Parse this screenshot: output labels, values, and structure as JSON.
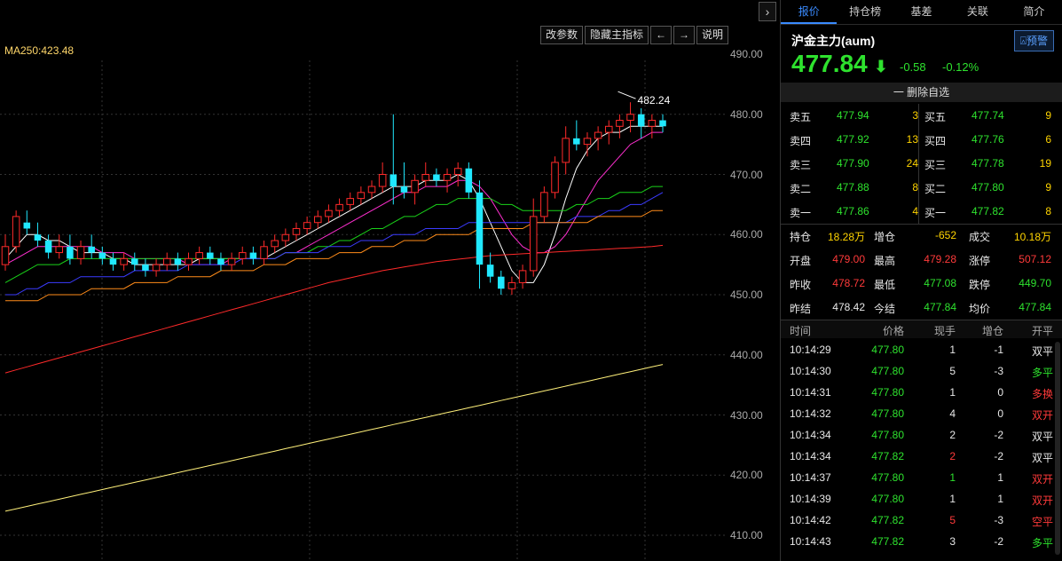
{
  "chart": {
    "ma250_label": "MA250:423.48",
    "toolbar": [
      "改参数",
      "隐藏主指标",
      "←",
      "→",
      "说明"
    ],
    "max_label": "482.24",
    "y_ticks": [
      "490.00",
      "480.00",
      "470.00",
      "460.00",
      "450.00",
      "440.00",
      "430.00",
      "420.00",
      "410.00"
    ]
  },
  "chart_data": {
    "type": "candlestick",
    "y_range": [
      406,
      492
    ],
    "candles": [
      [
        455,
        460,
        454,
        458
      ],
      [
        458,
        464,
        457,
        463
      ],
      [
        462,
        464,
        460,
        461
      ],
      [
        460,
        462,
        458,
        459
      ],
      [
        459,
        460,
        456,
        457
      ],
      [
        457,
        460,
        456,
        458
      ],
      [
        458,
        460,
        455,
        456
      ],
      [
        456,
        459,
        455,
        458
      ],
      [
        458,
        460,
        456,
        457
      ],
      [
        457,
        458,
        455,
        456
      ],
      [
        456,
        457,
        454,
        455
      ],
      [
        455,
        457,
        454,
        456
      ],
      [
        456,
        457,
        454,
        455
      ],
      [
        455,
        456,
        453,
        454
      ],
      [
        454,
        456,
        453,
        455
      ],
      [
        455,
        457,
        454,
        456
      ],
      [
        456,
        457,
        454,
        455
      ],
      [
        455,
        457,
        454,
        456
      ],
      [
        456,
        458,
        455,
        457
      ],
      [
        457,
        458,
        455,
        456
      ],
      [
        456,
        457,
        454,
        455
      ],
      [
        455,
        457,
        454,
        456
      ],
      [
        456,
        458,
        455,
        457
      ],
      [
        457,
        458,
        455,
        456
      ],
      [
        456,
        459,
        455,
        458
      ],
      [
        458,
        460,
        457,
        459
      ],
      [
        459,
        461,
        458,
        460
      ],
      [
        460,
        462,
        459,
        461
      ],
      [
        461,
        463,
        460,
        462
      ],
      [
        462,
        464,
        461,
        463
      ],
      [
        463,
        465,
        462,
        464
      ],
      [
        464,
        466,
        463,
        465
      ],
      [
        465,
        467,
        464,
        466
      ],
      [
        466,
        468,
        465,
        467
      ],
      [
        467,
        469,
        466,
        468
      ],
      [
        468,
        472,
        467,
        470
      ],
      [
        470,
        480,
        465,
        468
      ],
      [
        468,
        472,
        466,
        467
      ],
      [
        467,
        470,
        465,
        469
      ],
      [
        469,
        472,
        468,
        470
      ],
      [
        470,
        471,
        468,
        469
      ],
      [
        469,
        471,
        467,
        470
      ],
      [
        470,
        472,
        468,
        471
      ],
      [
        471,
        472,
        466,
        467
      ],
      [
        467,
        469,
        451,
        455
      ],
      [
        455,
        457,
        452,
        453
      ],
      [
        453,
        454,
        450,
        451
      ],
      [
        451,
        453,
        450,
        452
      ],
      [
        452,
        455,
        451,
        454
      ],
      [
        454,
        466,
        453,
        463
      ],
      [
        463,
        468,
        462,
        467
      ],
      [
        467,
        473,
        466,
        472
      ],
      [
        472,
        478,
        470,
        476
      ],
      [
        476,
        479,
        474,
        475
      ],
      [
        475,
        477,
        473,
        476
      ],
      [
        476,
        478,
        474,
        477
      ],
      [
        477,
        479,
        475,
        478
      ],
      [
        478,
        480,
        476,
        479
      ],
      [
        479,
        482,
        477,
        480
      ],
      [
        480,
        481,
        476,
        478
      ],
      [
        478,
        480,
        476,
        479
      ],
      [
        479,
        480,
        477,
        478
      ]
    ],
    "lines": {
      "MA5": [
        456,
        458,
        460,
        460,
        459,
        459,
        458,
        457,
        457,
        457,
        456,
        456,
        455,
        455,
        455,
        455,
        455,
        455,
        456,
        456,
        456,
        456,
        456,
        456,
        456,
        457,
        458,
        459,
        460,
        461,
        462,
        463,
        464,
        465,
        466,
        467,
        468,
        468,
        468,
        469,
        469,
        469,
        470,
        469,
        466,
        462,
        458,
        454,
        452,
        452,
        455,
        460,
        466,
        471,
        474,
        476,
        477,
        477,
        478,
        478,
        478,
        478
      ],
      "MA10": [
        455,
        456,
        457,
        458,
        458,
        458,
        458,
        458,
        458,
        457,
        457,
        457,
        456,
        456,
        456,
        456,
        456,
        455,
        455,
        455,
        455,
        456,
        456,
        456,
        456,
        456,
        457,
        457,
        458,
        459,
        460,
        461,
        462,
        463,
        464,
        465,
        466,
        467,
        467,
        468,
        468,
        468,
        469,
        469,
        468,
        466,
        463,
        460,
        458,
        457,
        457,
        458,
        460,
        463,
        466,
        469,
        471,
        473,
        475,
        476,
        477,
        477
      ],
      "MA20": [
        452,
        453,
        454,
        455,
        455,
        455,
        456,
        456,
        456,
        456,
        456,
        456,
        456,
        456,
        456,
        456,
        456,
        456,
        456,
        456,
        456,
        456,
        456,
        456,
        456,
        456,
        457,
        457,
        457,
        458,
        458,
        459,
        459,
        460,
        461,
        461,
        462,
        463,
        463,
        464,
        465,
        465,
        466,
        466,
        466,
        466,
        465,
        465,
        464,
        464,
        464,
        464,
        464,
        465,
        465,
        466,
        466,
        467,
        467,
        467,
        468,
        468
      ],
      "MA30": [
        450,
        450,
        451,
        451,
        452,
        452,
        452,
        453,
        453,
        453,
        453,
        453,
        454,
        454,
        454,
        454,
        454,
        455,
        455,
        455,
        455,
        455,
        456,
        456,
        456,
        456,
        457,
        457,
        457,
        457,
        458,
        458,
        458,
        459,
        459,
        459,
        460,
        460,
        460,
        461,
        461,
        461,
        461,
        462,
        462,
        462,
        462,
        462,
        462,
        462,
        462,
        462,
        462,
        463,
        463,
        463,
        464,
        464,
        465,
        465,
        466,
        467
      ],
      "MA60": [
        449,
        449,
        449,
        449,
        450,
        450,
        450,
        450,
        451,
        451,
        451,
        451,
        452,
        452,
        452,
        452,
        453,
        453,
        453,
        453,
        454,
        454,
        454,
        454,
        455,
        455,
        455,
        456,
        456,
        456,
        456,
        457,
        457,
        457,
        458,
        458,
        458,
        459,
        459,
        459,
        460,
        460,
        460,
        460,
        461,
        461,
        461,
        461,
        461,
        462,
        462,
        462,
        462,
        462,
        462,
        463,
        463,
        463,
        463,
        463,
        464,
        464
      ],
      "MA120": [
        437,
        437.5,
        438,
        438.5,
        439,
        439.5,
        440,
        440.5,
        441,
        441.5,
        442,
        442.5,
        443,
        443.5,
        444,
        444.5,
        445,
        445.5,
        446,
        446.5,
        447,
        447.5,
        448,
        448.5,
        449,
        449.5,
        450,
        450.5,
        451,
        451.5,
        452,
        452.4,
        452.8,
        453.2,
        453.6,
        454,
        454.3,
        454.6,
        454.9,
        455.2,
        455.5,
        455.7,
        455.9,
        456.1,
        456.3,
        456.5,
        456.6,
        456.7,
        456.8,
        456.9,
        457,
        457.1,
        457.2,
        457.3,
        457.4,
        457.5,
        457.6,
        457.7,
        457.8,
        457.9,
        458,
        458.2
      ],
      "MA250": [
        414,
        414.4,
        414.8,
        415.2,
        415.6,
        416,
        416.4,
        416.8,
        417.2,
        417.6,
        418,
        418.4,
        418.8,
        419.2,
        419.6,
        420,
        420.4,
        420.8,
        421.2,
        421.6,
        422,
        422.4,
        422.8,
        423.2,
        423.6,
        424,
        424.4,
        424.8,
        425.2,
        425.6,
        426,
        426.4,
        426.8,
        427.2,
        427.6,
        428,
        428.4,
        428.8,
        429.2,
        429.6,
        430,
        430.4,
        430.8,
        431.2,
        431.6,
        432,
        432.4,
        432.8,
        433.2,
        433.6,
        434,
        434.4,
        434.8,
        435.2,
        435.6,
        436,
        436.4,
        436.8,
        437.2,
        437.6,
        438,
        438.4
      ]
    }
  },
  "panel": {
    "tabs": [
      "报价",
      "持仓榜",
      "基差",
      "关联",
      "简介"
    ],
    "instrument": "沪金主力(aum)",
    "warn_label": "预警",
    "price": "477.84",
    "change": "-0.58",
    "change_pct": "-0.12%",
    "remove_label": "一 删除自选",
    "sells": [
      {
        "label": "卖五",
        "price": "477.94",
        "vol": "3"
      },
      {
        "label": "卖四",
        "price": "477.92",
        "vol": "13"
      },
      {
        "label": "卖三",
        "price": "477.90",
        "vol": "24"
      },
      {
        "label": "卖二",
        "price": "477.88",
        "vol": "8"
      },
      {
        "label": "卖一",
        "price": "477.86",
        "vol": "4"
      }
    ],
    "buys": [
      {
        "label": "买五",
        "price": "477.74",
        "vol": "9"
      },
      {
        "label": "买四",
        "price": "477.76",
        "vol": "6"
      },
      {
        "label": "买三",
        "price": "477.78",
        "vol": "19"
      },
      {
        "label": "买二",
        "price": "477.80",
        "vol": "9"
      },
      {
        "label": "买一",
        "price": "477.82",
        "vol": "8"
      }
    ],
    "stats": [
      [
        {
          "k": "持仓",
          "v": "18.28万",
          "c": "y"
        },
        {
          "k": "增仓",
          "v": "-652",
          "c": "y"
        },
        {
          "k": "成交",
          "v": "10.18万",
          "c": "y"
        }
      ],
      [
        {
          "k": "开盘",
          "v": "479.00",
          "c": "r"
        },
        {
          "k": "最高",
          "v": "479.28",
          "c": "r"
        },
        {
          "k": "涨停",
          "v": "507.12",
          "c": "r"
        }
      ],
      [
        {
          "k": "昨收",
          "v": "478.72",
          "c": "r"
        },
        {
          "k": "最低",
          "v": "477.08",
          "c": "g"
        },
        {
          "k": "跌停",
          "v": "449.70",
          "c": "g"
        }
      ],
      [
        {
          "k": "昨结",
          "v": "478.42",
          "c": "w"
        },
        {
          "k": "今结",
          "v": "477.84",
          "c": "g"
        },
        {
          "k": "均价",
          "v": "477.84",
          "c": "g"
        }
      ]
    ],
    "trade_headers": [
      "时间",
      "价格",
      "现手",
      "增仓",
      "开平"
    ],
    "trades": [
      {
        "t": "10:14:29",
        "p": "477.80",
        "v": "1",
        "vc": "w",
        "d": "-1",
        "o": "双平",
        "oc": "w"
      },
      {
        "t": "10:14:30",
        "p": "477.80",
        "v": "5",
        "vc": "w",
        "d": "-3",
        "o": "多平",
        "oc": "g"
      },
      {
        "t": "10:14:31",
        "p": "477.80",
        "v": "1",
        "vc": "w",
        "d": "0",
        "o": "多换",
        "oc": "r"
      },
      {
        "t": "10:14:32",
        "p": "477.80",
        "v": "4",
        "vc": "w",
        "d": "0",
        "o": "双开",
        "oc": "r"
      },
      {
        "t": "10:14:34",
        "p": "477.80",
        "v": "2",
        "vc": "w",
        "d": "-2",
        "o": "双平",
        "oc": "w"
      },
      {
        "t": "10:14:34",
        "p": "477.82",
        "v": "2",
        "vc": "r",
        "d": "-2",
        "o": "双平",
        "oc": "w"
      },
      {
        "t": "10:14:37",
        "p": "477.80",
        "v": "1",
        "vc": "g",
        "d": "1",
        "o": "双开",
        "oc": "r"
      },
      {
        "t": "10:14:39",
        "p": "477.80",
        "v": "1",
        "vc": "w",
        "d": "1",
        "o": "双开",
        "oc": "r"
      },
      {
        "t": "10:14:42",
        "p": "477.82",
        "v": "5",
        "vc": "r",
        "d": "-3",
        "o": "空平",
        "oc": "r"
      },
      {
        "t": "10:14:43",
        "p": "477.82",
        "v": "3",
        "vc": "w",
        "d": "-2",
        "o": "多平",
        "oc": "g"
      }
    ]
  }
}
